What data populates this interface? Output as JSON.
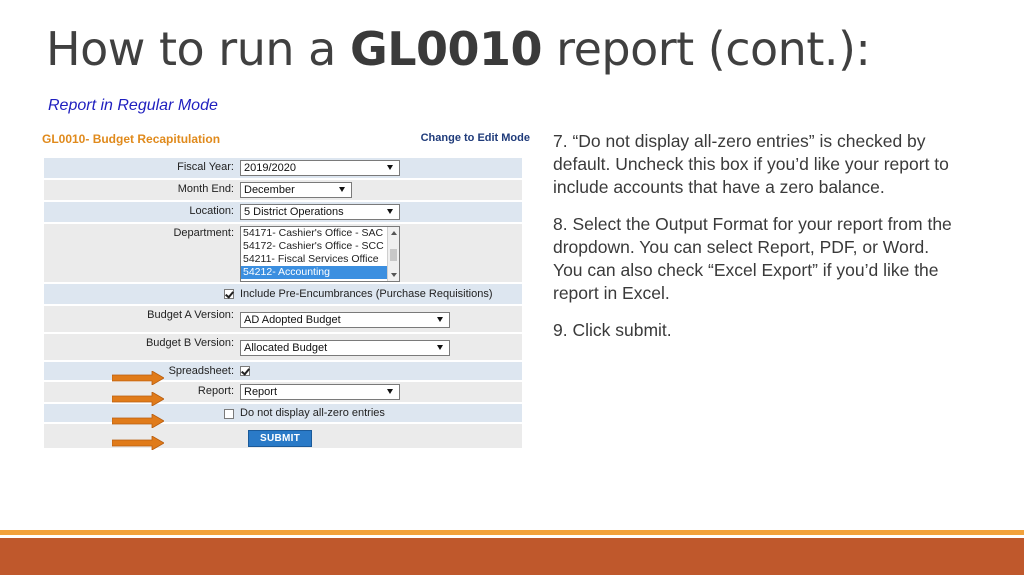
{
  "slide": {
    "title_prefix": "How to run a ",
    "title_bold": "GL0010",
    "title_suffix": " report (cont.):",
    "subtitle": "Report in Regular Mode"
  },
  "screenshot": {
    "form_title": "GL0010- Budget Recapitulation",
    "edit_link": "Change to Edit Mode",
    "fiscal_year": {
      "label": "Fiscal Year:",
      "value": "2019/2020"
    },
    "month_end": {
      "label": "Month End:",
      "value": "December"
    },
    "location": {
      "label": "Location:",
      "value": "5 District Operations"
    },
    "department": {
      "label": "Department:",
      "options": [
        "54171- Cashier's Office - SAC",
        "54172- Cashier's Office - SCC",
        "54211- Fiscal Services Office",
        "54212- Accounting"
      ]
    },
    "pre_encumbrances": {
      "label": "Include Pre-Encumbrances (Purchase Requisitions)",
      "checked": true
    },
    "budget_a": {
      "label": "Budget A Version:",
      "value": "AD Adopted Budget"
    },
    "budget_b": {
      "label": "Budget B Version:",
      "value": "Allocated Budget"
    },
    "spreadsheet": {
      "label": "Spreadsheet:",
      "checked": true
    },
    "report": {
      "label": "Report:",
      "value": "Report"
    },
    "zero_entries": {
      "label": "Do not display all-zero entries",
      "checked": false
    },
    "submit_label": "SUBMIT",
    "arrow_color": "#e07b1a"
  },
  "steps": [
    "7. “Do not display all-zero entries” is checked by default.  Uncheck this box if you’d like your report to include accounts that have a zero balance.",
    "8. Select the Output Format for your report from the dropdown.  You can select Report, PDF, or Word.  You can also check “Excel Export” if you’d like the report in Excel.",
    "9. Click submit."
  ],
  "colors": {
    "footer_line": "#f2a23c",
    "footer_bar": "#bf582c",
    "subtitle": "#1f1fbf"
  }
}
